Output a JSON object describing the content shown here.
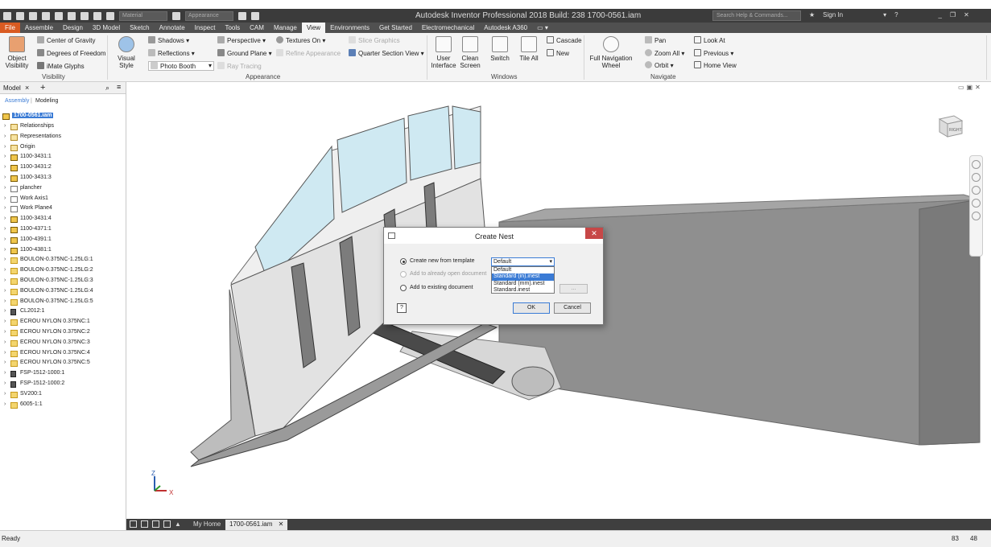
{
  "titlebar": {
    "app_title": "Autodesk Inventor Professional 2018 Build: 238    1700-0561.iam",
    "material_placeholder": "Material",
    "appearance_placeholder": "Appearance",
    "search_placeholder": "Search Help & Commands...",
    "sign_in": "Sign In"
  },
  "tabs": [
    "File",
    "Assemble",
    "Design",
    "3D Model",
    "Sketch",
    "Annotate",
    "Inspect",
    "Tools",
    "CAM",
    "Manage",
    "View",
    "Environments",
    "Get Started",
    "Electromechanical",
    "Autodesk A360"
  ],
  "active_tab": "View",
  "ribbon": {
    "visibility": {
      "object_visibility": "Object Visibility",
      "center_of_gravity": "Center of Gravity",
      "degrees_of_freedom": "Degrees of Freedom",
      "imate_glyphs": "iMate Glyphs",
      "label": "Visibility"
    },
    "appearance": {
      "visual_style": "Visual Style",
      "shadows": "Shadows",
      "reflections": "Reflections",
      "photo_booth": "Photo Booth",
      "perspective": "Perspective",
      "ground_plane": "Ground Plane",
      "ray_tracing": "Ray Tracing",
      "textures_on": "Textures On",
      "refine_appearance": "Refine Appearance",
      "slice_graphics": "Slice Graphics",
      "quarter_section_view": "Quarter Section View",
      "label": "Appearance"
    },
    "windows": {
      "user_interface": "User Interface",
      "clean_screen": "Clean Screen",
      "switch": "Switch",
      "tile_all": "Tile All",
      "cascade": "Cascade",
      "new": "New",
      "label": "Windows"
    },
    "navigate": {
      "full_navigation_wheel": "Full Navigation Wheel",
      "pan": "Pan",
      "zoom_all": "Zoom All",
      "orbit": "Orbit",
      "look_at": "Look At",
      "previous": "Previous",
      "home_view": "Home View",
      "label": "Navigate"
    }
  },
  "browser": {
    "tab_label": "Model",
    "sub_assembly": "Assembly",
    "sub_modeling": "Modeling",
    "root": "1700-0561.iam",
    "items": [
      {
        "label": "Relationships",
        "type": "folder"
      },
      {
        "label": "Representations",
        "type": "folder"
      },
      {
        "label": "Origin",
        "type": "folder"
      },
      {
        "label": "1100-3431:1",
        "type": "asm"
      },
      {
        "label": "1100-3431:2",
        "type": "asm"
      },
      {
        "label": "1100-3431:3",
        "type": "asm"
      },
      {
        "label": "plancher",
        "type": "plane"
      },
      {
        "label": "Work Axis1",
        "type": "plane"
      },
      {
        "label": "Work Plane4",
        "type": "plane"
      },
      {
        "label": "1100-3431:4",
        "type": "asm"
      },
      {
        "label": "1100-4371:1",
        "type": "asm"
      },
      {
        "label": "1100-4391:1",
        "type": "asm"
      },
      {
        "label": "1100-4381:1",
        "type": "asm"
      },
      {
        "label": "BOULON-0.375NC-1.25LG:1",
        "type": "part"
      },
      {
        "label": "BOULON-0.375NC-1.25LG:2",
        "type": "part"
      },
      {
        "label": "BOULON-0.375NC-1.25LG:3",
        "type": "part"
      },
      {
        "label": "BOULON-0.375NC-1.25LG:4",
        "type": "part"
      },
      {
        "label": "BOULON-0.375NC-1.25LG:5",
        "type": "part"
      },
      {
        "label": "CL2012:1",
        "type": "multi"
      },
      {
        "label": "ECROU NYLON 0.375NC:1",
        "type": "part"
      },
      {
        "label": "ECROU NYLON 0.375NC:2",
        "type": "part"
      },
      {
        "label": "ECROU NYLON 0.375NC:3",
        "type": "part"
      },
      {
        "label": "ECROU NYLON 0.375NC:4",
        "type": "part"
      },
      {
        "label": "ECROU NYLON 0.375NC:5",
        "type": "part"
      },
      {
        "label": "FSP-1512-1000:1",
        "type": "multi"
      },
      {
        "label": "FSP-1512-1000:2",
        "type": "multi"
      },
      {
        "label": "SV200:1",
        "type": "part"
      },
      {
        "label": "6005-1:1",
        "type": "part"
      }
    ]
  },
  "dialog": {
    "title": "Create Nest",
    "opt_new_template": "Create new from template",
    "opt_open_document": "Add to already open document",
    "opt_existing_document": "Add to existing document",
    "dropdown_value": "Default",
    "dropdown_options": [
      "Default",
      "Standard (in).inest",
      "Standard (mm).inest",
      "Standard.inest"
    ],
    "highlighted_option": 1,
    "browse": "...",
    "help": "?",
    "ok": "OK",
    "cancel": "Cancel"
  },
  "viewcube_label": "RIGHT",
  "doc_tabs": {
    "home": "My Home",
    "active": "1700-0561.iam"
  },
  "status": {
    "text": "Ready",
    "num1": "83",
    "num2": "48"
  },
  "axis": {
    "x": "X",
    "z": "Z"
  },
  "colors": {
    "file_tab": "#d95b22",
    "glass": "#cfe9f2",
    "blade": "#dcdcdc",
    "box": "#8a8a8a",
    "selection": "#3a7bd5"
  }
}
